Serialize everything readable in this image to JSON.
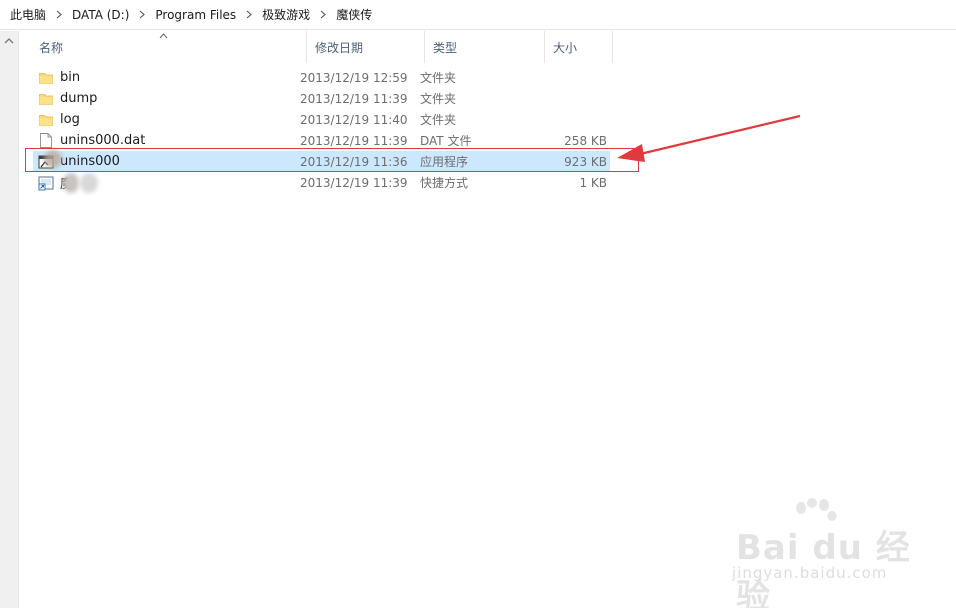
{
  "breadcrumb": [
    "此电脑",
    "DATA (D:)",
    "Program Files",
    "极致游戏",
    "魔侠传"
  ],
  "columns": {
    "name": "名称",
    "date": "修改日期",
    "type": "类型",
    "size": "大小"
  },
  "files": [
    {
      "icon": "folder-icon",
      "name": "bin",
      "date": "2013/12/19 12:59",
      "type": "文件夹",
      "size": ""
    },
    {
      "icon": "folder-icon",
      "name": "dump",
      "date": "2013/12/19 11:39",
      "type": "文件夹",
      "size": ""
    },
    {
      "icon": "folder-icon",
      "name": "log",
      "date": "2013/12/19 11:40",
      "type": "文件夹",
      "size": ""
    },
    {
      "icon": "file-icon",
      "name": "unins000.dat",
      "date": "2013/12/19 11:39",
      "type": "DAT 文件",
      "size": "258 KB"
    },
    {
      "icon": "application-icon",
      "name": "unins000",
      "date": "2013/12/19 11:36",
      "type": "应用程序",
      "size": "923 KB",
      "selected": true
    },
    {
      "icon": "shortcut-icon",
      "name": "魔",
      "date": "2013/12/19 11:39",
      "type": "快捷方式",
      "size": "1 KB"
    }
  ],
  "colors": {
    "selection": "#cce8ff",
    "annotation": "#e0393e",
    "header_text": "#4c607a"
  },
  "watermark": {
    "brand": "Bai du 经验",
    "url": "jingyan.baidu.com"
  }
}
